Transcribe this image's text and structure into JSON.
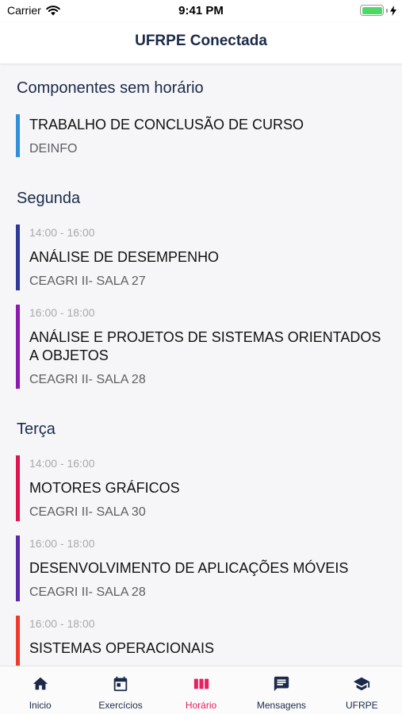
{
  "status_bar": {
    "carrier": "Carrier",
    "time": "9:41 PM"
  },
  "nav": {
    "title": "UFRPE Conectada"
  },
  "sections": [
    {
      "title": "Componentes sem horário",
      "items": [
        {
          "time": "",
          "title": "TRABALHO DE CONCLUSÃO DE CURSO",
          "place": "DEINFO",
          "color": "#2f8fd8"
        }
      ]
    },
    {
      "title": "Segunda",
      "items": [
        {
          "time": "14:00 - 16:00",
          "title": "ANÁLISE DE DESEMPENHO",
          "place": "CEAGRI II- SALA 27",
          "color": "#2e3a9a"
        },
        {
          "time": "16:00 - 18:00",
          "title": "ANÁLISE E PROJETOS DE SISTEMAS ORIENTADOS A OBJETOS",
          "place": "CEAGRI II- SALA 28",
          "color": "#8e1ab0"
        }
      ]
    },
    {
      "title": "Terça",
      "items": [
        {
          "time": "14:00 - 16:00",
          "title": "MOTORES GRÁFICOS",
          "place": "CEAGRI II- SALA 30",
          "color": "#e0154f"
        },
        {
          "time": "16:00 - 18:00",
          "title": "DESENVOLVIMENTO DE APLICAÇÕES MÓVEIS",
          "place": "CEAGRI II- SALA 28",
          "color": "#5a2aa8"
        },
        {
          "time": "16:00 - 18:00",
          "title": "SISTEMAS OPERACIONAIS",
          "place": "",
          "color": "#ef3b2c"
        }
      ]
    }
  ],
  "tabs": [
    {
      "label": "Inicio",
      "icon": "home-icon",
      "active": false
    },
    {
      "label": "Exercícios",
      "icon": "calendar-icon",
      "active": false
    },
    {
      "label": "Horário",
      "icon": "schedule-icon",
      "active": true
    },
    {
      "label": "Mensagens",
      "icon": "message-icon",
      "active": false
    },
    {
      "label": "UFRPE",
      "icon": "graduation-cap-icon",
      "active": false
    }
  ],
  "colors": {
    "navy": "#1b2a4a",
    "accent": "#e91e63"
  }
}
